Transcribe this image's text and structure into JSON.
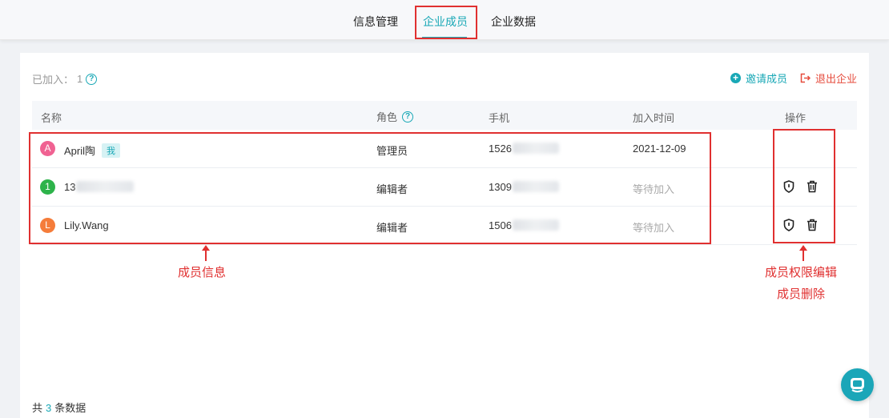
{
  "tabs": [
    {
      "label": "信息管理"
    },
    {
      "label": "企业成员"
    },
    {
      "label": "企业数据"
    }
  ],
  "summary": {
    "joined_label": "已加入：",
    "joined_count": "1",
    "invite_label": "邀请成员",
    "exit_label": "退出企业"
  },
  "table": {
    "headers": {
      "name": "名称",
      "role": "角色",
      "phone": "手机",
      "joined_time": "加入时间",
      "actions": "操作"
    },
    "rows": [
      {
        "avatar": "A",
        "avatar_color": "#f06292",
        "name": "April陶",
        "badge": "我",
        "role": "管理员",
        "phone": "1526",
        "time": "2021-12-09"
      },
      {
        "avatar": "1",
        "avatar_color": "#2db34a",
        "name": "13",
        "badge": "",
        "role": "编辑者",
        "phone": "1309",
        "time": "等待加入"
      },
      {
        "avatar": "L",
        "avatar_color": "#f57c3a",
        "name": "Lily.Wang",
        "badge": "",
        "role": "编辑者",
        "phone": "1506",
        "time": "等待加入"
      }
    ]
  },
  "annotations": {
    "member_info": "成员信息",
    "permission_edit": "成员权限编辑",
    "member_delete": "成员删除"
  },
  "footer": {
    "prefix": "共",
    "count": "3",
    "suffix": "条数据"
  },
  "colors": {
    "accent": "#19a8b6",
    "danger": "#e64b3c",
    "annotation": "#e03030"
  },
  "icons": [
    "help-icon",
    "plus-circle-icon",
    "exit-icon",
    "shield-icon",
    "trash-icon",
    "headset-icon"
  ]
}
